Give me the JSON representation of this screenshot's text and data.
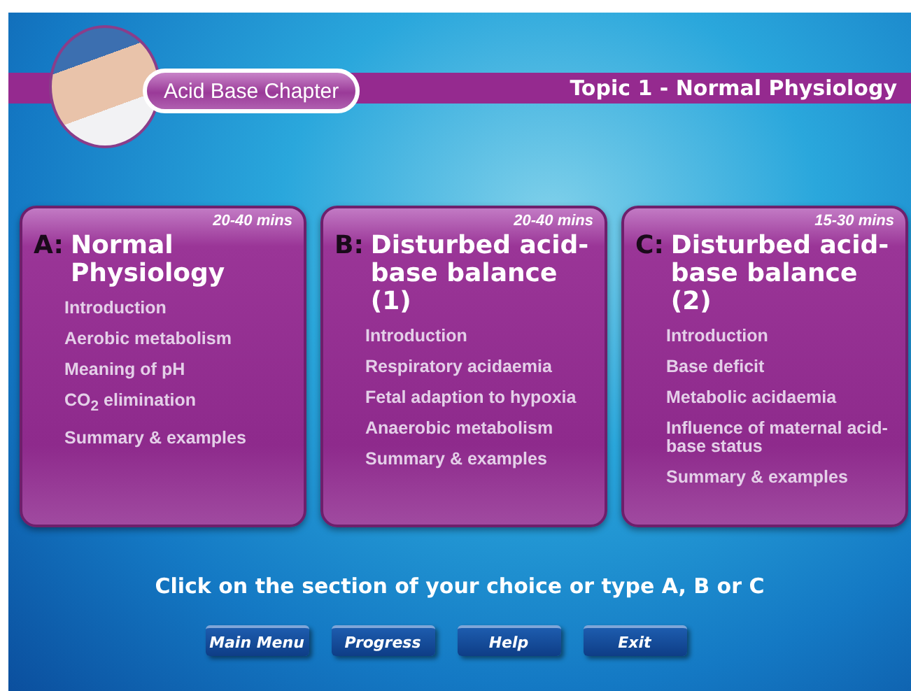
{
  "header": {
    "chapter": "Acid Base Chapter",
    "topic": "Topic 1 - Normal Physiology"
  },
  "sections": [
    {
      "letter": "A:",
      "title": "Normal Physiology",
      "duration": "20-40 mins",
      "items": [
        "Introduction",
        "Aerobic metabolism",
        "Meaning of pH",
        "CO$_{2}$ elimination",
        "Summary & examples"
      ]
    },
    {
      "letter": "B:",
      "title": "Disturbed acid-base balance (1)",
      "duration": "20-40 mins",
      "items": [
        "Introduction",
        "Respiratory acidaemia",
        "Fetal adaption to hypoxia",
        "Anaerobic metabolism",
        "Summary & examples"
      ]
    },
    {
      "letter": "C:",
      "title": "Disturbed acid-base balance (2)",
      "duration": "15-30 mins",
      "items": [
        "Introduction",
        "Base deficit",
        "Metabolic acidaemia",
        "Influence of maternal acid-base status",
        "Summary & examples"
      ]
    }
  ],
  "instruction": "Click on the section of your choice or type A, B or C",
  "buttons": [
    "Main Menu",
    "Progress",
    "Help",
    "Exit"
  ]
}
